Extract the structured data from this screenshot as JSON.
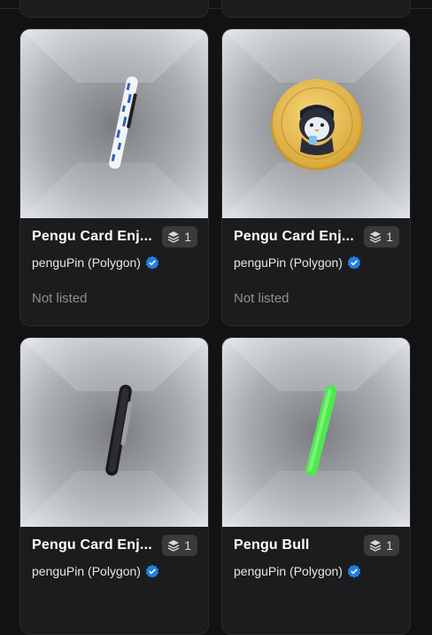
{
  "cards": [
    {
      "title": "",
      "collection": "",
      "badge_count": "",
      "status": "",
      "verified": false,
      "icon": "",
      "ghost": true
    },
    {
      "title": "",
      "collection": "",
      "badge_count": "",
      "status": "",
      "verified": false,
      "icon": "",
      "ghost": true
    },
    {
      "title": "Pengu Card Enj...",
      "collection": "penguPin (Polygon)",
      "badge_count": "1",
      "status": "Not listed",
      "verified": true,
      "icon": "edge-coin-white-blue"
    },
    {
      "title": "Pengu Card Enj...",
      "collection": "penguPin (Polygon)",
      "badge_count": "1",
      "status": "Not listed",
      "verified": true,
      "icon": "gold-penguin-coin"
    },
    {
      "title": "Pengu Card Enj...",
      "collection": "penguPin (Polygon)",
      "badge_count": "1",
      "status": "",
      "verified": true,
      "icon": "edge-coin-black"
    },
    {
      "title": "Pengu Bull",
      "collection": "penguPin (Polygon)",
      "badge_count": "1",
      "status": "",
      "verified": true,
      "icon": "edge-coin-green"
    }
  ],
  "colors": {
    "background": "#121212",
    "card": "#1c1c1e",
    "badge": "#3a3a3d",
    "verified": "#2081e2",
    "coin_gold": "#e5b84a",
    "coin_green": "#4ee94e"
  }
}
